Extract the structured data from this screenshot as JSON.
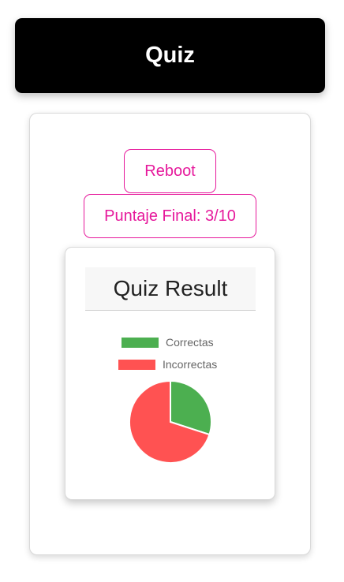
{
  "header": {
    "title": "Quiz"
  },
  "actions": {
    "reboot_label": "Reboot",
    "score_label": "Puntaje Final: 3/10"
  },
  "result": {
    "title": "Quiz Result"
  },
  "colors": {
    "accent": "#e61a9c",
    "correct": "#4caf50",
    "incorrect": "#ff5252"
  },
  "chart_data": {
    "type": "pie",
    "categories": [
      "Correctas",
      "Incorrectas"
    ],
    "values": [
      3,
      7
    ],
    "legend": "top"
  }
}
